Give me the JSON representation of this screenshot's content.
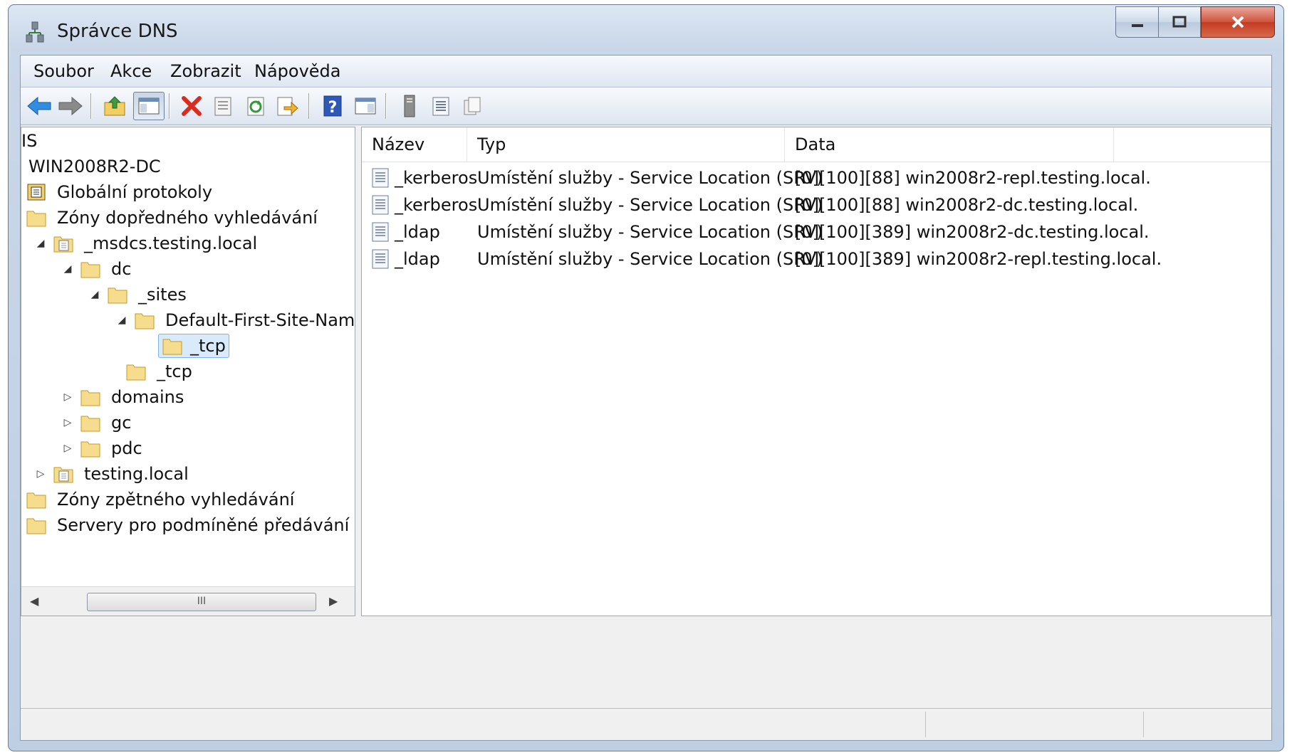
{
  "window": {
    "title": "Správce DNS"
  },
  "menu": [
    "Soubor",
    "Akce",
    "Zobrazit",
    "Nápověda"
  ],
  "toolbar": [
    "back-icon",
    "forward-icon",
    "up-folder-icon",
    "show-hide-tree-icon",
    "delete-icon",
    "properties-icon",
    "refresh-icon",
    "export-icon",
    "help-icon",
    "show-hide-action-pane-icon",
    "server-icon",
    "list-icon",
    "copy-icon"
  ],
  "tree": {
    "root": "IS",
    "server": "WIN2008R2-DC",
    "global_logs": "Globální protokoly",
    "forward_zones": "Zóny dopředného vyhledávání",
    "msdcs": "_msdcs.testing.local",
    "dc": "dc",
    "sites": "_sites",
    "default_site": "Default-First-Site-Name",
    "site_tcp": "_tcp",
    "dc_tcp": "_tcp",
    "domains": "domains",
    "gc": "gc",
    "pdc": "pdc",
    "testing_local": "testing.local",
    "reverse_zones": "Zóny zpětného vyhledávání",
    "conditional": "Servery pro podmíněné předávání",
    "scroll_thumb": "III"
  },
  "list": {
    "columns": [
      "Název",
      "Typ",
      "Data"
    ],
    "rows": [
      {
        "name": "_kerberos",
        "type": "Umístění služby - Service Location (SRV)",
        "data": "[0][100][88] win2008r2-repl.testing.local."
      },
      {
        "name": "_kerberos",
        "type": "Umístění služby - Service Location (SRV)",
        "data": "[0][100][88] win2008r2-dc.testing.local."
      },
      {
        "name": "_ldap",
        "type": "Umístění služby - Service Location (SRV)",
        "data": "[0][100][389] win2008r2-dc.testing.local."
      },
      {
        "name": "_ldap",
        "type": "Umístění služby - Service Location (SRV)",
        "data": "[0][100][389] win2008r2-repl.testing.local."
      }
    ]
  },
  "colors": {
    "selection": "#d9ebfb",
    "selection_border": "#7eb4ea",
    "close_red": "#c23b20",
    "accent_blue": "#2b5fb3"
  }
}
